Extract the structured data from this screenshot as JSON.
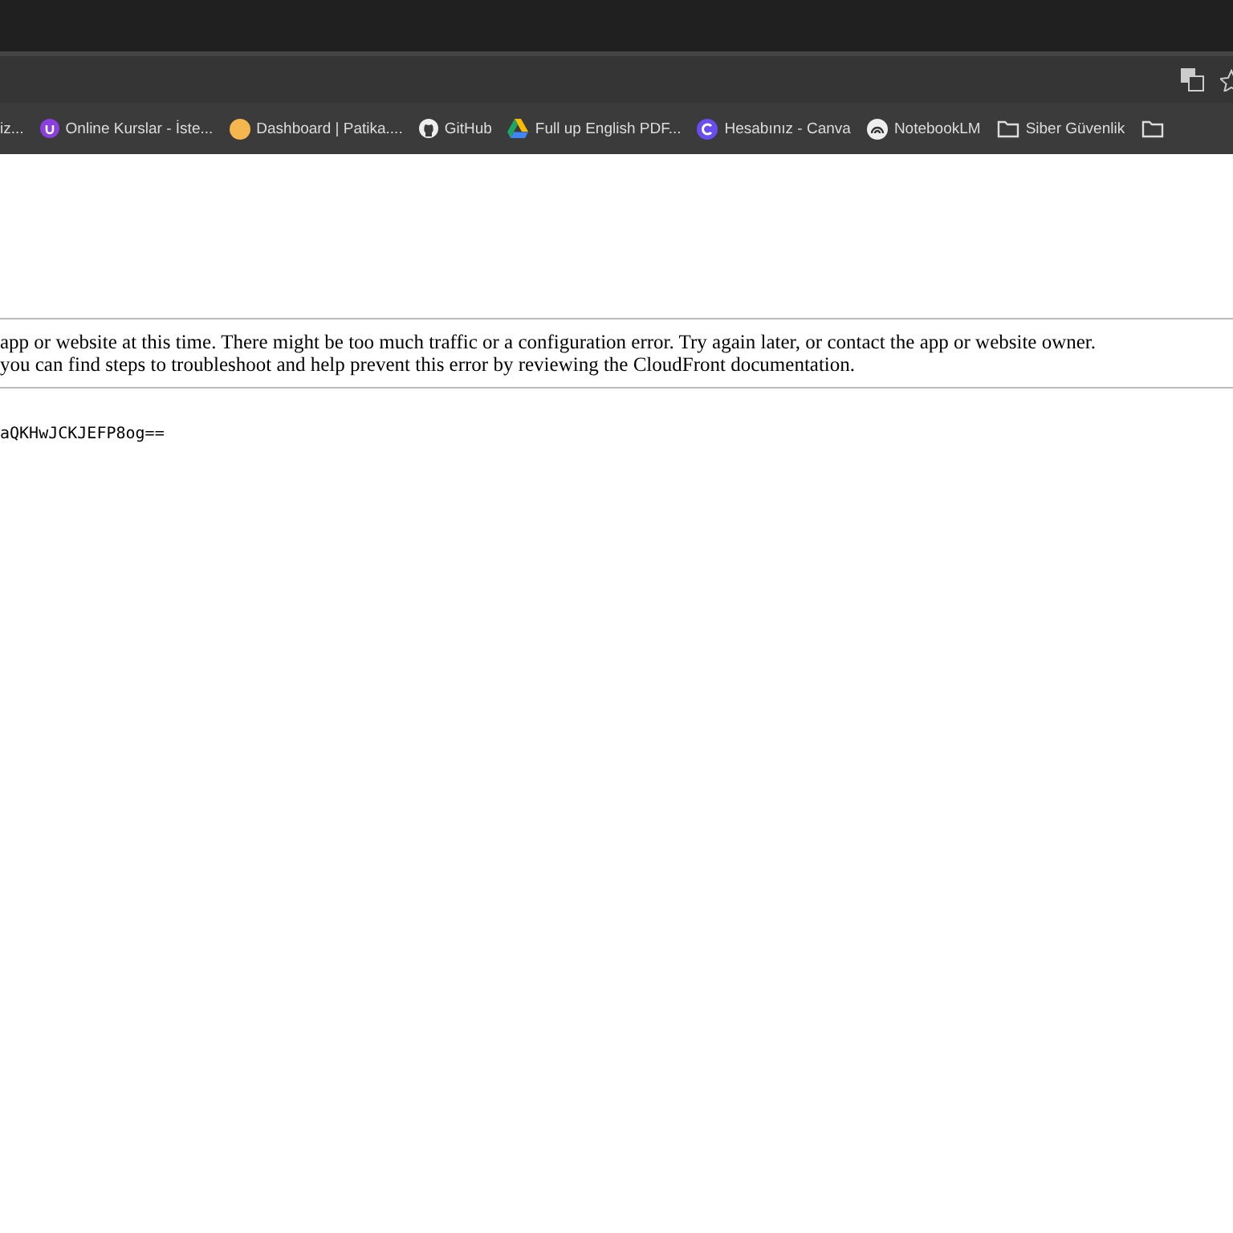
{
  "bookmarks": [
    {
      "kind": "none",
      "label": "iz..."
    },
    {
      "kind": "udemy",
      "label": "Online Kurslar - İste..."
    },
    {
      "kind": "dot",
      "label": "Dashboard | Patika...."
    },
    {
      "kind": "github",
      "label": "GitHub"
    },
    {
      "kind": "drive",
      "label": "Full up English PDF..."
    },
    {
      "kind": "canva",
      "label": "Hesabınız - Canva"
    },
    {
      "kind": "notebook",
      "label": "NotebookLM"
    },
    {
      "kind": "folder",
      "label": "Siber Güvenlik"
    },
    {
      "kind": "folder"
    }
  ],
  "message": [
    "app or website at this time. There might be too much traffic or a configuration error. Try again later, or contact the app or website owner.",
    "you can find steps to troubleshoot and help prevent this error by reviewing the CloudFront documentation."
  ],
  "request_id": "aQKHwJCKJEFP8og=="
}
